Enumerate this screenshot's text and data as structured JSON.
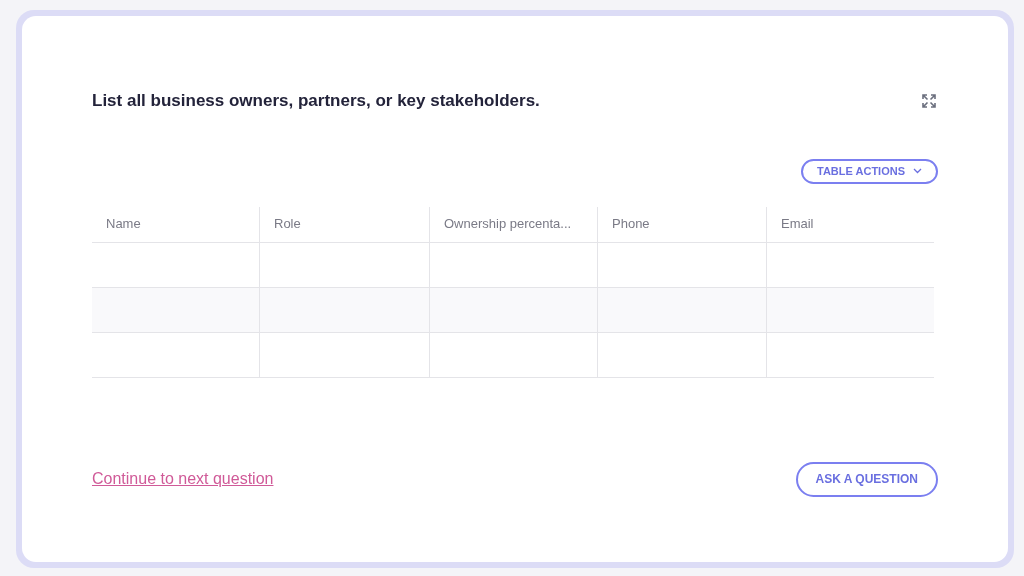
{
  "question": "List all business owners, partners, or key stakeholders.",
  "table_actions": {
    "label": "TABLE ACTIONS"
  },
  "table": {
    "columns": [
      "Name",
      "Role",
      "Ownership percenta...",
      "Phone",
      "Email"
    ]
  },
  "continue_link": "Continue to next question",
  "ask_button": "ASK A QUESTION"
}
